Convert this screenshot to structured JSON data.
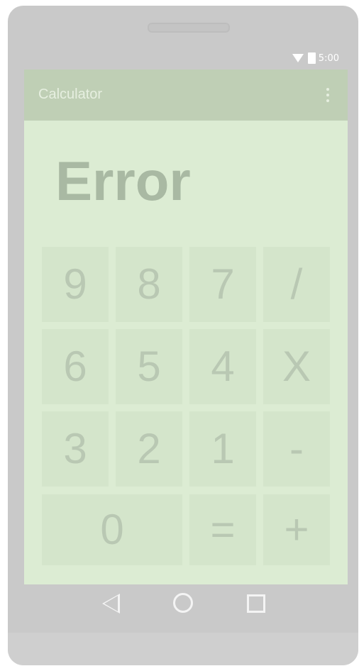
{
  "status_bar": {
    "time": "5:00",
    "icons": [
      "wifi-icon",
      "battery-icon"
    ]
  },
  "app": {
    "title": "Calculator",
    "menu_icon": "more-vert-icon"
  },
  "display": {
    "value": "Error"
  },
  "keys": [
    [
      "9",
      "8",
      "7",
      "/"
    ],
    [
      "6",
      "5",
      "4",
      "X"
    ],
    [
      "3",
      "2",
      "1",
      "-"
    ],
    [
      "0",
      "=",
      "+"
    ]
  ],
  "nav_bar": {
    "icons": [
      "back-icon",
      "home-icon",
      "recents-icon"
    ]
  },
  "colors": {
    "app_bar": "#bfcfb5",
    "screen_bg": "#dcecd3",
    "key_bg": "#d4e5cb",
    "key_text": "#b9c8b3",
    "display_text": "#a9b9a3",
    "device_frame": "#c9c9c9"
  }
}
